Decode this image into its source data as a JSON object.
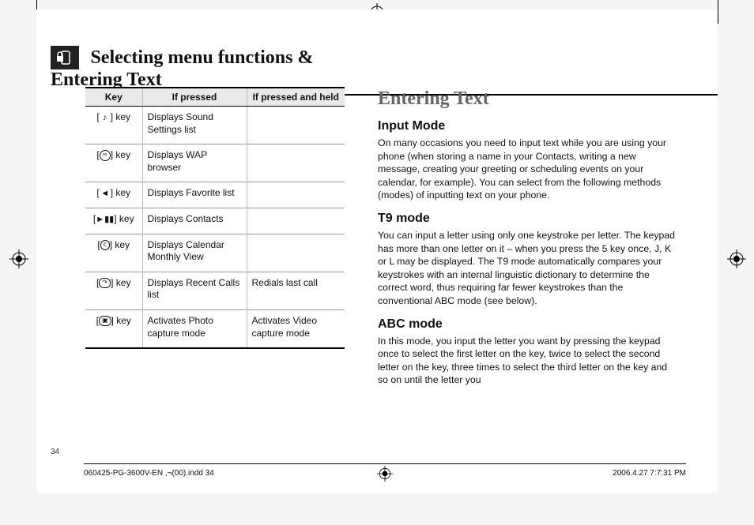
{
  "header": {
    "title": "Selecting menu functions & Entering Text"
  },
  "table": {
    "headers": {
      "key": "Key",
      "pressed": "If pressed",
      "held": "If pressed and held"
    },
    "rows": [
      {
        "key_icon": "sound-key-icon",
        "key_label": "key",
        "key_glyph": "♪",
        "pressed": "Displays Sound Settings list",
        "held": ""
      },
      {
        "key_icon": "wap-key-icon",
        "key_label": "key",
        "key_glyph": "∞",
        "pressed": "Displays WAP browser",
        "held": ""
      },
      {
        "key_icon": "favorite-key-icon",
        "key_label": "key",
        "key_glyph": "◄",
        "pressed": "Displays Favorite list",
        "held": ""
      },
      {
        "key_icon": "contacts-key-icon",
        "key_label": "key",
        "key_glyph": "►▮▮",
        "pressed": "Displays Contacts",
        "held": ""
      },
      {
        "key_icon": "calendar-key-icon",
        "key_label": "key",
        "key_glyph": "c",
        "pressed": "Displays Calendar Monthly View",
        "held": ""
      },
      {
        "key_icon": "recent-key-icon",
        "key_label": "key",
        "key_glyph": "↷",
        "pressed": "Displays Recent Calls list",
        "held": "Redials last call"
      },
      {
        "key_icon": "camera-key-icon",
        "key_label": "key",
        "key_glyph": "▣",
        "pressed": "Activates Photo capture mode",
        "held": "Activates Video capture mode"
      }
    ]
  },
  "right": {
    "heading": "Entering Text",
    "sections": [
      {
        "title": "Input Mode",
        "body": "On many occasions you need to input text while you are using your phone (when storing a name in your Contacts, writing a new message, creating your greeting or scheduling events on your calendar, for example). You can select from the following methods (modes) of inputting text on your phone."
      },
      {
        "title": "T9 mode",
        "body": "You can input a letter using only one keystroke per letter. The keypad has more than one letter on it – when you press the 5 key once, J, K or L may be displayed. The T9 mode automatically compares your keystrokes with an internal linguistic dictionary to determine the correct word, thus requiring far fewer keystrokes than the conventional ABC mode (see below)."
      },
      {
        "title": "ABC mode",
        "body": "In this mode, you input the letter you want by pressing the keypad once to select the first letter on the key, twice to select the second letter on the key, three times to select the third letter on the key and so on until the letter you"
      }
    ]
  },
  "page_number": "34",
  "footer": {
    "left": "060425-PG-3600V-EN ,¬(00).indd   34",
    "right": "2006.4.27   7:7:31 PM"
  }
}
